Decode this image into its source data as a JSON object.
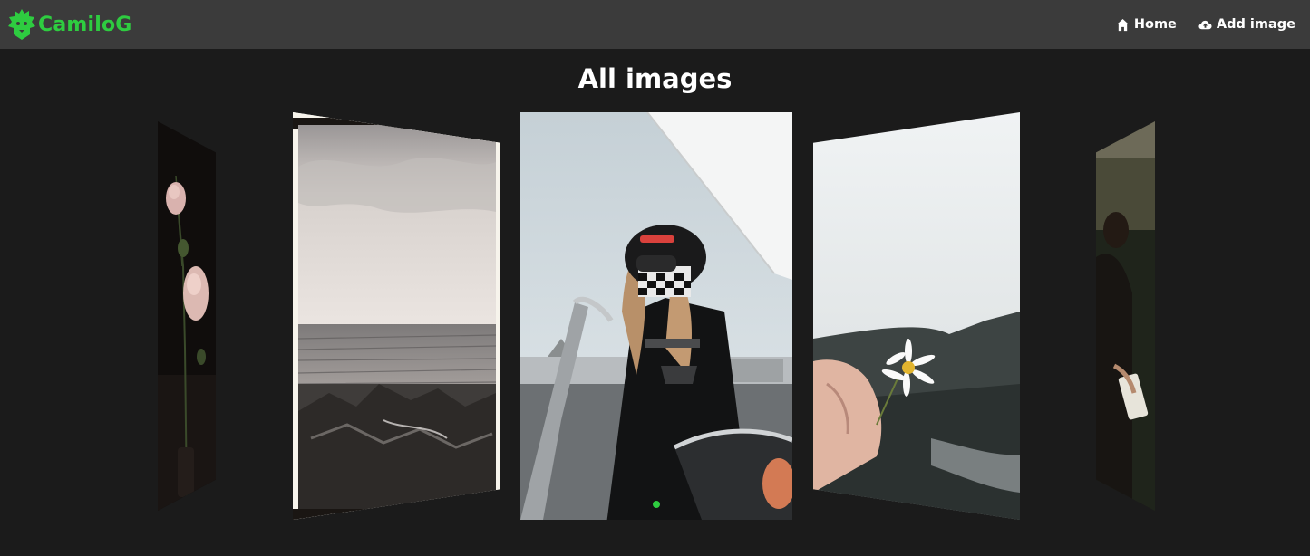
{
  "brand": {
    "name": "CamiloG",
    "logo_icon": "lion-icon",
    "color": "#2ecc40"
  },
  "nav": {
    "links": [
      {
        "label": "Home",
        "icon": "home-icon"
      },
      {
        "label": "Add image",
        "icon": "cloud-upload-icon"
      }
    ]
  },
  "page": {
    "title": "All images"
  },
  "carousel": {
    "active_index": 2,
    "slides": [
      {
        "subject": "pink roses on dark background",
        "icon": "image-icon"
      },
      {
        "subject": "sea waves and rocks, film frame",
        "icon": "image-icon"
      },
      {
        "subject": "woman in checkered helmet on motorcycle",
        "icon": "image-icon"
      },
      {
        "subject": "hand holding a daisy",
        "icon": "image-icon"
      },
      {
        "subject": "person in field holding book",
        "icon": "image-icon"
      }
    ],
    "indicator_color": "#2ecc40"
  },
  "colors": {
    "navbar": "#3b3b3b",
    "background": "#1b1b1b",
    "accent": "#2ecc40"
  }
}
